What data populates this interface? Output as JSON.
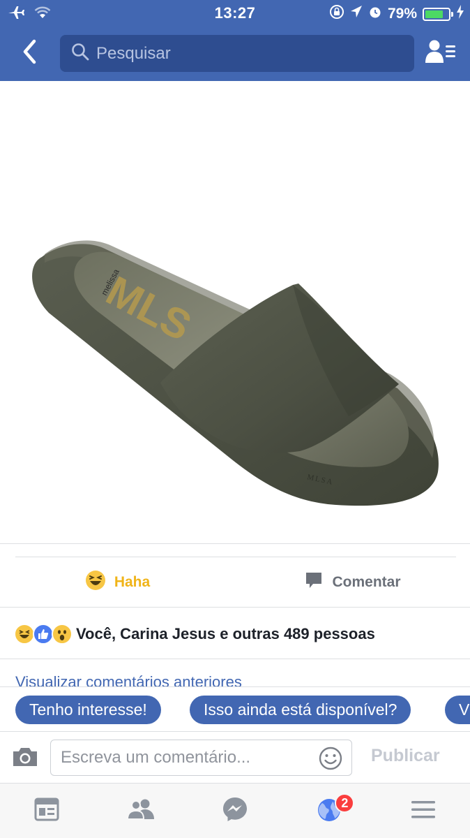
{
  "status_bar": {
    "time": "13:27",
    "battery_percent": "79%",
    "battery_level": 0.79,
    "icons": [
      "airplane-icon",
      "wifi-icon",
      "orientation-lock-icon",
      "location-icon",
      "alarm-icon",
      "battery-icon",
      "charging-icon"
    ]
  },
  "nav": {
    "back_icon": "chevron-left-icon",
    "search_placeholder": "Pesquisar",
    "friends_icon": "friend-list-icon"
  },
  "post": {
    "image_alt": "olive green slide sandal",
    "actions": {
      "haha": "Haha",
      "comment": "Comentar"
    },
    "reactions": {
      "icons": [
        "haha-icon",
        "like-icon",
        "wow-icon"
      ],
      "summary": "Você, Carina Jesus e outras 489 pessoas"
    },
    "previous_comments": "Visualizar comentários anteriores"
  },
  "quick_replies": [
    "Tenho interesse!",
    "Isso ainda está disponível?",
    "V"
  ],
  "composer": {
    "placeholder": "Escreva um comentário...",
    "publish_label": "Publicar"
  },
  "tabbar": {
    "items": [
      "news-feed-icon",
      "friends-icon",
      "messenger-icon",
      "notifications-globe-icon",
      "menu-icon"
    ],
    "notifications_badge": "2"
  },
  "colors": {
    "brand_blue": "#4267b2",
    "search_bg": "#2e4d90",
    "haha_yellow": "#f0b419",
    "badge_red": "#fa3e3e",
    "sandal_olive": "#4f5346"
  }
}
